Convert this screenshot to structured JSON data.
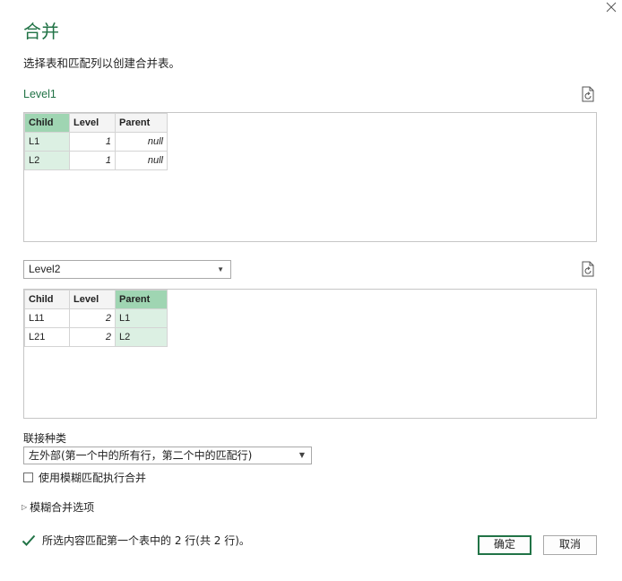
{
  "dialog": {
    "title": "合并",
    "subtitle": "选择表和匹配列以创建合并表。",
    "accent_color": "#217346"
  },
  "table1": {
    "name": "Level1",
    "headers": [
      "Child",
      "Level",
      "Parent"
    ],
    "rows": [
      [
        "L1",
        "1",
        "null"
      ],
      [
        "L2",
        "1",
        "null"
      ]
    ],
    "selected_column": "Child"
  },
  "table2": {
    "selected_query": "Level2",
    "headers": [
      "Child",
      "Level",
      "Parent"
    ],
    "rows": [
      [
        "L11",
        "2",
        "L1"
      ],
      [
        "L21",
        "2",
        "L2"
      ]
    ],
    "selected_column": "Parent"
  },
  "join": {
    "label": "联接种类",
    "selected": "左外部(第一个中的所有行，第二个中的匹配行)",
    "fuzzy_checkbox_label": "使用模糊匹配执行合并",
    "fuzzy_checked": false,
    "fuzzy_options_label": "模糊合并选项"
  },
  "status": {
    "message": "所选内容匹配第一个表中的 2 行(共 2 行)。",
    "icon": "checkmark-icon"
  },
  "buttons": {
    "ok": "确定",
    "cancel": "取消"
  }
}
